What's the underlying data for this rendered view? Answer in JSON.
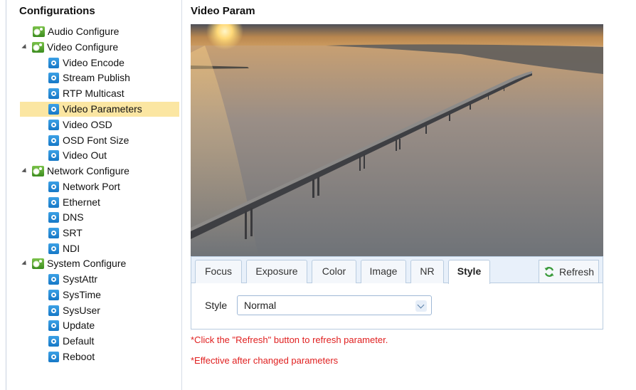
{
  "sidebar": {
    "title": "Configurations",
    "items": [
      {
        "label": "Audio Configure",
        "icon": "gear-group-icon"
      },
      {
        "label": "Video Configure",
        "icon": "gear-group-icon"
      },
      {
        "label": "Video Encode",
        "icon": "gear-icon"
      },
      {
        "label": "Stream Publish",
        "icon": "gear-icon"
      },
      {
        "label": "RTP Multicast",
        "icon": "gear-icon"
      },
      {
        "label": "Video Parameters",
        "icon": "gear-icon",
        "selected": true
      },
      {
        "label": "Video OSD",
        "icon": "gear-icon"
      },
      {
        "label": "OSD Font Size",
        "icon": "gear-icon"
      },
      {
        "label": "Video Out",
        "icon": "gear-icon"
      },
      {
        "label": "Network Configure",
        "icon": "gear-group-icon"
      },
      {
        "label": "Network Port",
        "icon": "gear-icon"
      },
      {
        "label": "Ethernet",
        "icon": "gear-icon"
      },
      {
        "label": "DNS",
        "icon": "gear-icon"
      },
      {
        "label": "SRT",
        "icon": "gear-icon"
      },
      {
        "label": "NDI",
        "icon": "gear-icon"
      },
      {
        "label": "System Configure",
        "icon": "gear-group-icon"
      },
      {
        "label": "SystAttr",
        "icon": "gear-icon"
      },
      {
        "label": "SysTime",
        "icon": "gear-icon"
      },
      {
        "label": "SysUser",
        "icon": "gear-icon"
      },
      {
        "label": "Update",
        "icon": "gear-icon"
      },
      {
        "label": "Default",
        "icon": "gear-icon"
      },
      {
        "label": "Reboot",
        "icon": "gear-icon"
      }
    ]
  },
  "main": {
    "title": "Video Param",
    "tabs": [
      "Focus",
      "Exposure",
      "Color",
      "Image",
      "NR",
      "Style"
    ],
    "active_tab": "Style",
    "refresh_label": "Refresh",
    "style_label": "Style",
    "style_value": "Normal",
    "note_refresh": "*Click the \"Refresh\" button to refresh parameter.",
    "note_effective": "*Effective after changed parameters"
  },
  "colors": {
    "selected_bg": "#fbe6a2",
    "note_red": "#e02020",
    "tab_border": "#b9cce0"
  }
}
